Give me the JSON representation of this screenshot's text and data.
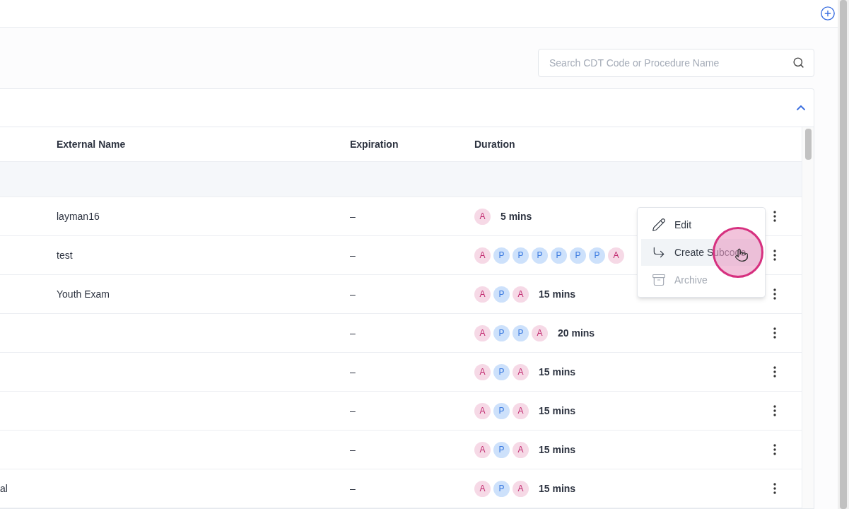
{
  "search": {
    "placeholder": "Search CDT Code or Procedure Name"
  },
  "table": {
    "columns": [
      "External Name",
      "Expiration",
      "Duration"
    ],
    "rows": [
      {
        "external_name": "layman16",
        "expiration": "–",
        "duration": {
          "badges": [
            {
              "label": "A",
              "kind": "pink"
            }
          ],
          "text": "5 mins"
        }
      },
      {
        "external_name": "test",
        "expiration": "–",
        "duration": {
          "badges": [
            {
              "label": "A",
              "kind": "pink"
            },
            {
              "label": "P",
              "kind": "blue"
            },
            {
              "label": "P",
              "kind": "blue"
            },
            {
              "label": "P",
              "kind": "blue"
            },
            {
              "label": "P",
              "kind": "blue"
            },
            {
              "label": "P",
              "kind": "blue"
            },
            {
              "label": "P",
              "kind": "blue"
            },
            {
              "label": "A",
              "kind": "pink"
            }
          ]
        }
      },
      {
        "external_name": "Youth Exam",
        "expiration": "–",
        "duration": {
          "badges": [
            {
              "label": "A",
              "kind": "pink"
            },
            {
              "label": "P",
              "kind": "blue"
            },
            {
              "label": "A",
              "kind": "pink"
            }
          ],
          "text": "15 mins"
        }
      },
      {
        "expiration": "–",
        "duration": {
          "badges": [
            {
              "label": "A",
              "kind": "pink"
            },
            {
              "label": "P",
              "kind": "blue"
            },
            {
              "label": "P",
              "kind": "blue"
            },
            {
              "label": "A",
              "kind": "pink"
            }
          ],
          "text": "20 mins"
        }
      },
      {
        "expiration": "–",
        "duration": {
          "badges": [
            {
              "label": "A",
              "kind": "pink"
            },
            {
              "label": "P",
              "kind": "blue"
            },
            {
              "label": "A",
              "kind": "pink"
            }
          ],
          "text": "15 mins"
        }
      },
      {
        "expiration": "–",
        "duration": {
          "badges": [
            {
              "label": "A",
              "kind": "pink"
            },
            {
              "label": "P",
              "kind": "blue"
            },
            {
              "label": "A",
              "kind": "pink"
            }
          ],
          "text": "15 mins"
        }
      },
      {
        "expiration": "–",
        "duration": {
          "badges": [
            {
              "label": "A",
              "kind": "pink"
            },
            {
              "label": "P",
              "kind": "blue"
            },
            {
              "label": "A",
              "kind": "pink"
            }
          ],
          "text": "15 mins"
        }
      },
      {
        "column_1": "al",
        "expiration": "–",
        "duration": {
          "badges": [
            {
              "label": "A",
              "kind": "pink"
            },
            {
              "label": "P",
              "kind": "blue"
            },
            {
              "label": "A",
              "kind": "pink"
            }
          ],
          "text": "15 mins"
        }
      }
    ]
  },
  "context_menu": {
    "items": [
      {
        "label": "Edit",
        "kind": "edit",
        "selected": false,
        "disabled": false
      },
      {
        "label": "Create Subcode",
        "kind": "subcode",
        "selected": true,
        "disabled": false
      },
      {
        "label": "Archive",
        "kind": "archive",
        "selected": false,
        "disabled": true
      }
    ]
  }
}
